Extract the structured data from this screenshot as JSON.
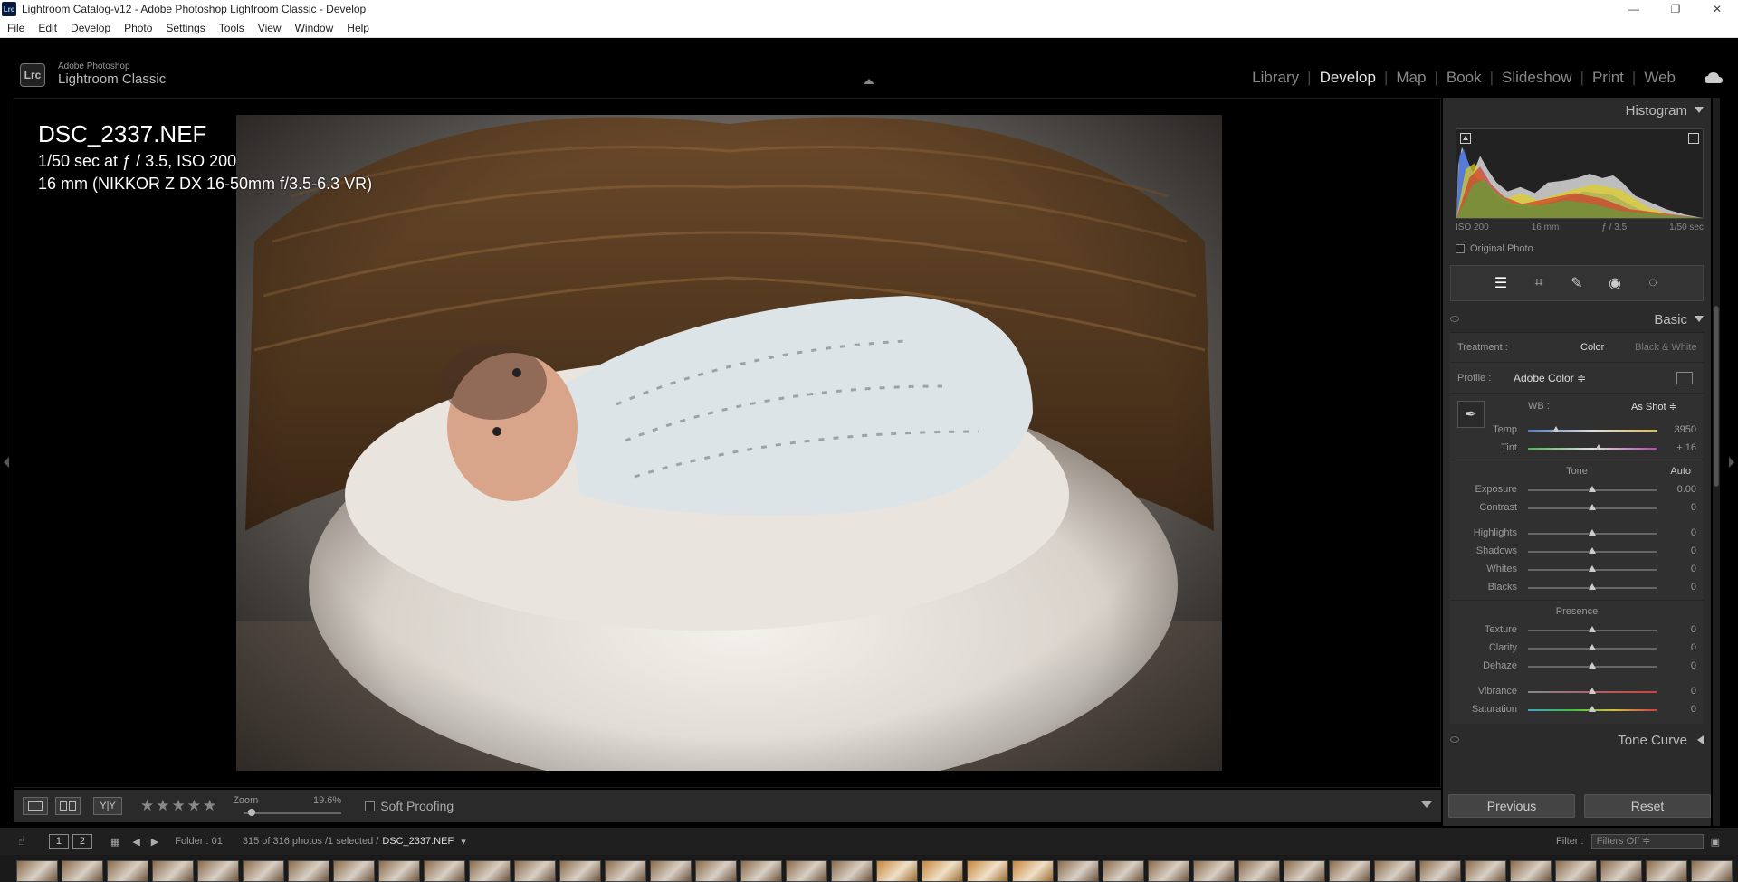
{
  "window": {
    "app_icon": "Lrc",
    "title": "Lightroom Catalog-v12 - Adobe Photoshop Lightroom Classic - Develop"
  },
  "menu": [
    "File",
    "Edit",
    "Develop",
    "Photo",
    "Settings",
    "Tools",
    "View",
    "Window",
    "Help"
  ],
  "brand": {
    "logo": "Lrc",
    "line1": "Adobe Photoshop",
    "line2": "Lightroom Classic"
  },
  "modules": [
    "Library",
    "Develop",
    "Map",
    "Book",
    "Slideshow",
    "Print",
    "Web"
  ],
  "active_module": "Develop",
  "photo_info": {
    "filename": "DSC_2337.NEF",
    "exposure": "1/50 sec at ƒ / 3.5, ISO 200",
    "lens": "16 mm (NIKKOR Z DX 16-50mm f/3.5-6.3 VR)"
  },
  "toolbar": {
    "rating_stars": "★★★★★",
    "zoom_label": "Zoom",
    "zoom_value": "19.6%",
    "zoom_level": 0.05,
    "soft_proofing": "Soft Proofing"
  },
  "histogram": {
    "title": "Histogram",
    "meta": [
      "ISO 200",
      "16 mm",
      "ƒ / 3.5",
      "1/50 sec"
    ],
    "original_photo": "Original Photo"
  },
  "basic": {
    "title": "Basic",
    "treatment_label": "Treatment :",
    "treatment_color": "Color",
    "treatment_bw": "Black & White",
    "profile_label": "Profile :",
    "profile_value": "Adobe Color ≑",
    "wb_label": "WB :",
    "wb_value": "As Shot ≑",
    "tone_label": "Tone",
    "auto_label": "Auto",
    "presence_label": "Presence",
    "wb_sliders": [
      {
        "label": "Temp",
        "value": "3950",
        "pos": 0.22
      },
      {
        "label": "Tint",
        "value": "+ 16",
        "pos": 0.55
      }
    ],
    "tone_sliders_a": [
      {
        "label": "Exposure",
        "value": "0.00",
        "pos": 0.5
      },
      {
        "label": "Contrast",
        "value": "0",
        "pos": 0.5
      }
    ],
    "tone_sliders_b": [
      {
        "label": "Highlights",
        "value": "0",
        "pos": 0.5
      },
      {
        "label": "Shadows",
        "value": "0",
        "pos": 0.5
      },
      {
        "label": "Whites",
        "value": "0",
        "pos": 0.5
      },
      {
        "label": "Blacks",
        "value": "0",
        "pos": 0.5
      }
    ],
    "presence_sliders_a": [
      {
        "label": "Texture",
        "value": "0",
        "pos": 0.5
      },
      {
        "label": "Clarity",
        "value": "0",
        "pos": 0.5
      },
      {
        "label": "Dehaze",
        "value": "0",
        "pos": 0.5
      }
    ],
    "presence_sliders_b": [
      {
        "label": "Vibrance",
        "value": "0",
        "pos": 0.5
      },
      {
        "label": "Saturation",
        "value": "0",
        "pos": 0.5
      }
    ]
  },
  "tone_curve": {
    "title": "Tone Curve"
  },
  "buttons": {
    "previous": "Previous",
    "reset": "Reset"
  },
  "filmbar": {
    "view1": "1",
    "view2": "2",
    "folder": "Folder : 01",
    "count": "315 of 316 photos /1 selected /",
    "current": "DSC_2337.NEF",
    "filter_label": "Filter :",
    "filter_value": "Filters Off ≑"
  },
  "colors": {
    "panel_bg": "#2b2b2b",
    "temp_track": "#4a7fd0",
    "tint_track": "#c040c0"
  }
}
